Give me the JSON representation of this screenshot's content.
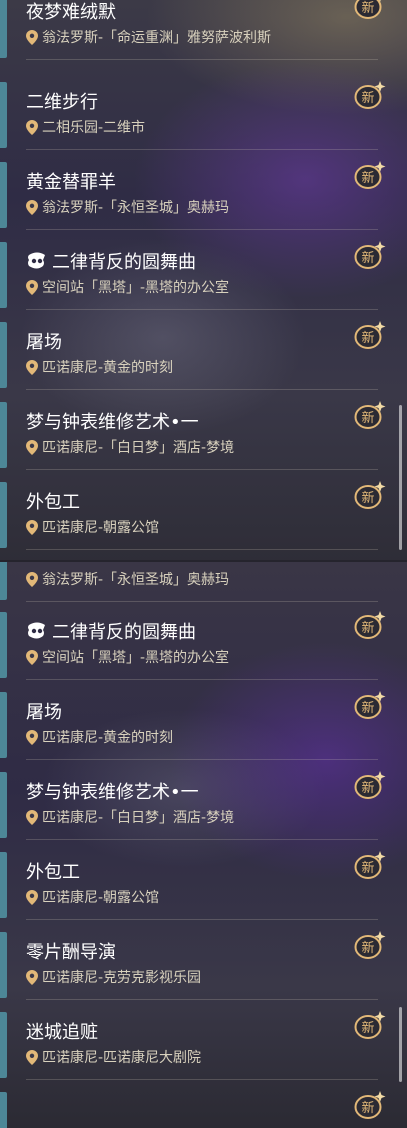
{
  "badge_label": "新",
  "colors": {
    "accent": "#4d8797",
    "badge": "#e2b878",
    "location_text": "#d8d1bd"
  },
  "panel_top": {
    "items": [
      {
        "title": "夜梦难绒默",
        "location": "翁法罗斯-「命运重渊」雅努萨波利斯"
      },
      {
        "title": "二维步行",
        "location": "二相乐园-二维市"
      },
      {
        "title": "黄金替罪羊",
        "location": "翁法罗斯-「永恒圣城」奥赫玛"
      },
      {
        "title": "二律背反的圆舞曲",
        "location": "空间站「黑塔」-黑塔的办公室",
        "icon": "ticket-icon"
      },
      {
        "title": "屠场",
        "location": "匹诺康尼-黄金的时刻"
      },
      {
        "title": "梦与钟表维修艺术•一",
        "location": "匹诺康尼-「白日梦」酒店-梦境"
      },
      {
        "title": "外包工",
        "location": "匹诺康尼-朝露公馆"
      }
    ]
  },
  "panel_bottom": {
    "partial_location": "翁法罗斯-「永恒圣城」奥赫玛",
    "items": [
      {
        "title": "二律背反的圆舞曲",
        "location": "空间站「黑塔」-黑塔的办公室",
        "icon": "ticket-icon"
      },
      {
        "title": "屠场",
        "location": "匹诺康尼-黄金的时刻"
      },
      {
        "title": "梦与钟表维修艺术•一",
        "location": "匹诺康尼-「白日梦」酒店-梦境"
      },
      {
        "title": "外包工",
        "location": "匹诺康尼-朝露公馆"
      },
      {
        "title": "零片酬导演",
        "location": "匹诺康尼-克劳克影视乐园"
      },
      {
        "title": "迷城追赃",
        "location": "匹诺康尼-匹诺康尼大剧院"
      }
    ]
  }
}
